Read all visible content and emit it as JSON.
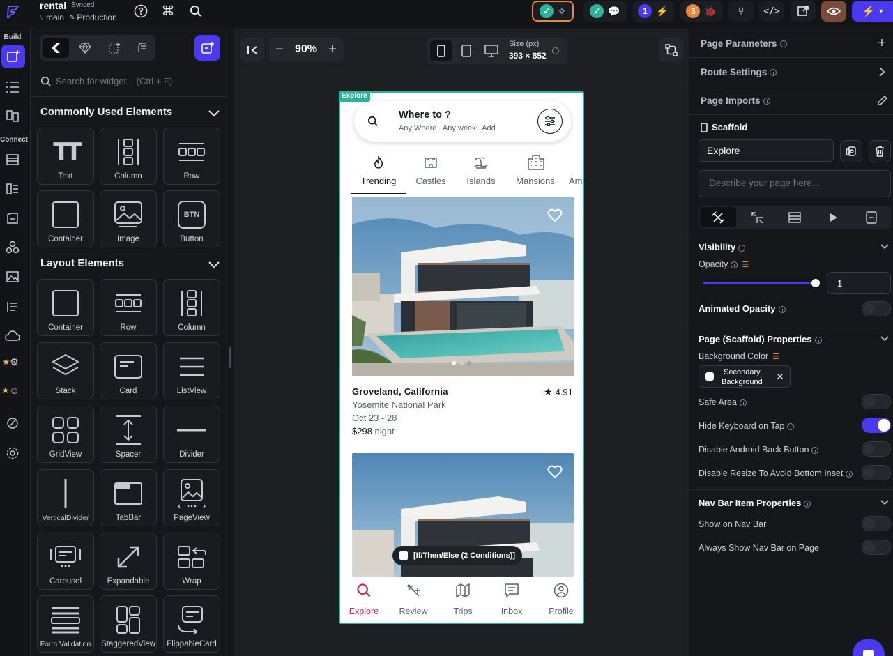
{
  "header": {
    "project_name": "rental",
    "sync_status": "Synced",
    "branch": "main",
    "environment": "Production",
    "badge_issues_count": "1",
    "badge_warnings_count": "3"
  },
  "left_rail": {
    "build_label": "Build",
    "connect_label": "Connect"
  },
  "widget_panel": {
    "search_placeholder": "Search for widget... (Ctrl + F)",
    "common_title": "Commonly Used Elements",
    "common_items": [
      "Text",
      "Column",
      "Row",
      "Container",
      "Image",
      "Button"
    ],
    "layout_title": "Layout Elements",
    "layout_items": [
      "Container",
      "Row",
      "Column",
      "Stack",
      "Card",
      "ListView",
      "GridView",
      "Spacer",
      "Divider",
      "VerticalDivider",
      "TabBar",
      "PageView",
      "Carousel",
      "Expandable",
      "Wrap",
      "Form Validation",
      "StaggeredView",
      "FlippableCard"
    ],
    "button_glyph": "BTN"
  },
  "canvas": {
    "zoom": "90%",
    "size_label": "Size (px)",
    "size_value": "393 × 852",
    "page_tag": "Explore",
    "conditional_label": "[If/Then/Else (2 Conditions)]"
  },
  "app_preview": {
    "search_title": "Where to ?",
    "search_subtitle": "Any Where . Any week . Add",
    "categories": [
      "Trending",
      "Castles",
      "Islands",
      "Mansions",
      "Am"
    ],
    "listing": {
      "title": "Groveland, California",
      "rating": "4.91",
      "subtitle": "Yosemite National Park",
      "dates": "Oct 23 - 28",
      "price": "$298",
      "price_unit": "night"
    },
    "nav": [
      "Explore",
      "Review",
      "Trips",
      "Inbox",
      "Profile"
    ],
    "accent": "#c3275a"
  },
  "properties": {
    "page_parameters": "Page Parameters",
    "route_settings": "Route Settings",
    "page_imports": "Page Imports",
    "scaffold_label": "Scaffold",
    "page_name_value": "Explore",
    "description_placeholder": "Describe your page here...",
    "visibility_title": "Visibility",
    "opacity_label": "Opacity",
    "opacity_value": "1",
    "animated_opacity": "Animated Opacity",
    "scaffold_props_title": "Page (Scaffold) Properties",
    "background_color_label": "Background Color",
    "background_color_value_line1": "Secondary",
    "background_color_value_line2": "Background",
    "safe_area": "Safe Area",
    "hide_keyboard": "Hide Keyboard on Tap",
    "disable_back": "Disable Android Back Button",
    "disable_resize": "Disable Resize To Avoid Bottom Inset",
    "navbar_title": "Nav Bar Item Properties",
    "show_nav": "Show on Nav Bar",
    "always_show_nav": "Always Show Nav Bar on Page"
  },
  "colors": {
    "brand_primary": "#4b39ef",
    "teal": "#2bb39a",
    "badge_orange": "#e8883a"
  }
}
